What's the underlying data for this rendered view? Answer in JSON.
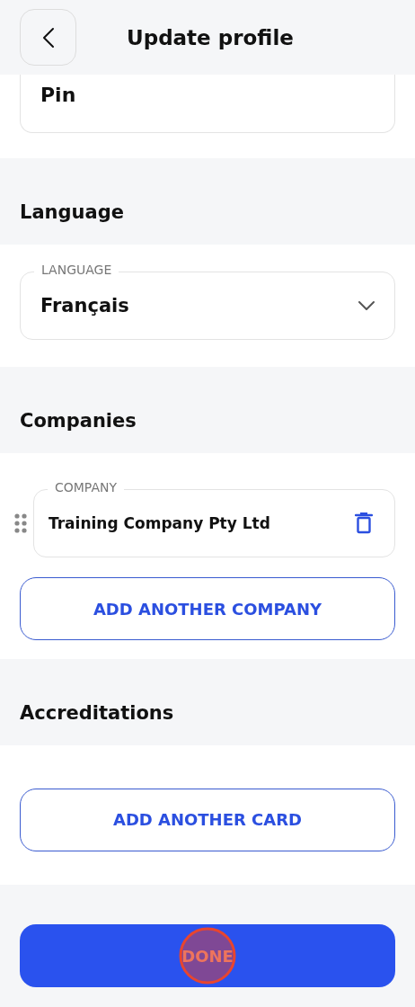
{
  "header": {
    "title": "Update profile"
  },
  "pin_field": {
    "value": "Pin"
  },
  "language": {
    "heading": "Language",
    "field": {
      "label": "LANGUAGE",
      "value": "Français"
    }
  },
  "companies": {
    "heading": "Companies",
    "items": [
      {
        "label": "COMPANY",
        "value": "Training Company Pty Ltd"
      }
    ],
    "add_button": "ADD ANOTHER COMPANY"
  },
  "accreditations": {
    "heading": "Accreditations",
    "add_button": "ADD ANOTHER CARD"
  },
  "done_button": "DONE"
}
